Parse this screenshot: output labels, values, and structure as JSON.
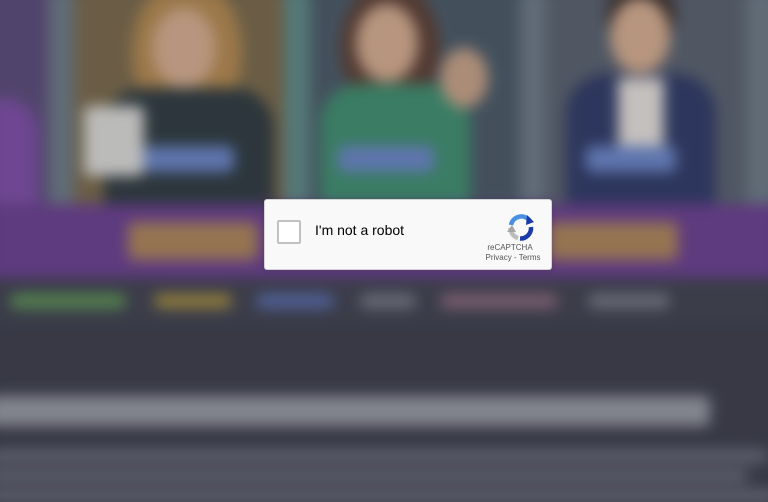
{
  "captcha": {
    "checkbox_label": "I'm not a robot",
    "brand": "reCAPTCHA",
    "privacy_link": "Privacy",
    "separator": " - ",
    "terms_link": "Terms",
    "checked": false,
    "icon": "recaptcha-logo-icon"
  },
  "colors": {
    "captcha_background": "#f9f9f9",
    "captcha_border": "#d3d3d3",
    "checkbox_border": "#c1c1c1",
    "logo_blue": "#4a90e2",
    "logo_dark_blue": "#1c3aa9",
    "logo_grey": "#bdbdbd",
    "page_purple_band": "#6b3f90",
    "page_background": "#3c3d4e"
  }
}
